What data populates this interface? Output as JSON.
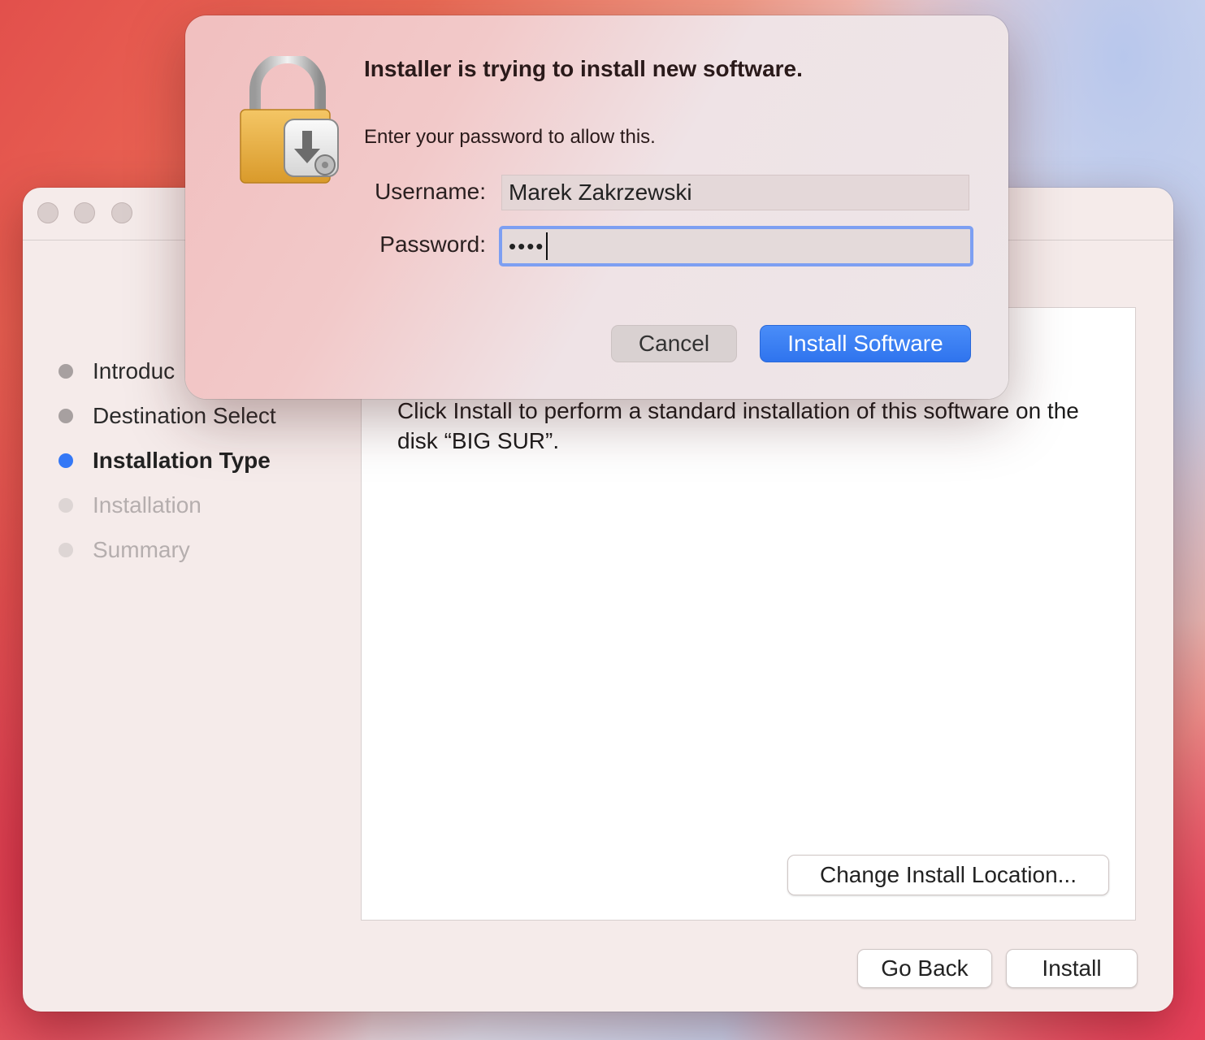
{
  "installer": {
    "steps": [
      {
        "label": "Introduc",
        "state": "done"
      },
      {
        "label": "Destination Select",
        "state": "done"
      },
      {
        "label": "Installation Type",
        "state": "current"
      },
      {
        "label": "Installation",
        "state": "pending"
      },
      {
        "label": "Summary",
        "state": "pending"
      }
    ],
    "content_text": "Click Install to perform a standard installation of this software on the disk “BIG SUR”.",
    "change_location_label": "Change Install Location...",
    "go_back_label": "Go Back",
    "install_label": "Install"
  },
  "dialog": {
    "icon": "lock-download-icon",
    "title": "Installer is trying to install new software.",
    "message": "Enter your password to allow this.",
    "username_label": "Username:",
    "username_value": "Marek Zakrzewski",
    "password_label": "Password:",
    "password_value": "••••",
    "cancel_label": "Cancel",
    "confirm_label": "Install Software"
  },
  "colors": {
    "accent": "#3478f6",
    "focus_ring": "#7d9ff2"
  }
}
